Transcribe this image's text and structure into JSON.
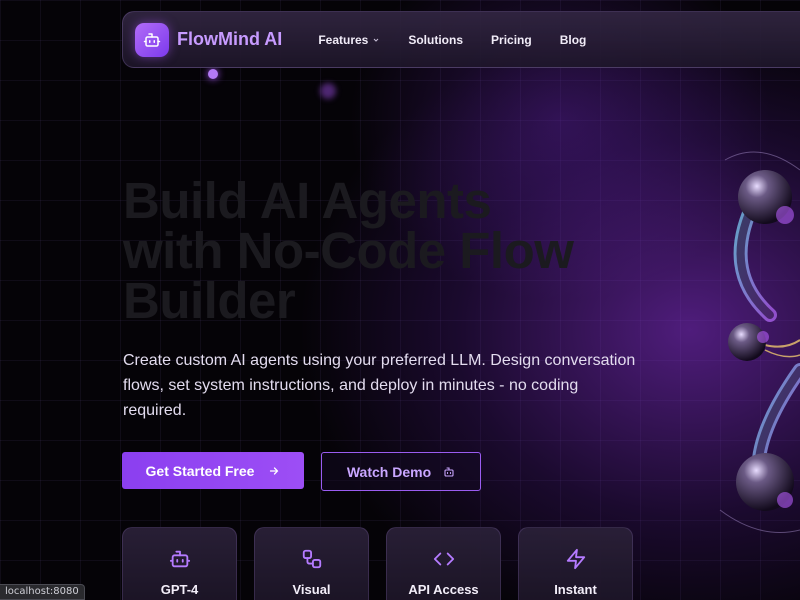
{
  "brand": {
    "name": "FlowMind AI",
    "logo_icon": "bot-icon"
  },
  "nav": {
    "features": "Features",
    "solutions": "Solutions",
    "pricing": "Pricing",
    "blog": "Blog"
  },
  "hero": {
    "title_line1": "Build AI Agents",
    "title_line2": "with No-Code Flow",
    "title_line3": "Builder",
    "subtitle": "Create custom AI agents using your preferred LLM. Design conversation flows, set system instructions, and deploy in minutes - no coding required."
  },
  "cta": {
    "primary_label": "Get Started Free",
    "secondary_label": "Watch Demo"
  },
  "features": [
    {
      "label": "GPT-4",
      "icon": "bot-icon"
    },
    {
      "label": "Visual",
      "icon": "workflow-icon"
    },
    {
      "label": "API Access",
      "icon": "code-icon"
    },
    {
      "label": "Instant",
      "icon": "zap-icon"
    }
  ],
  "status_bar": {
    "url": "localhost:8080"
  },
  "colors": {
    "accent": "#9d4ef5",
    "accent_light": "#c79bff",
    "background": "#050307",
    "card": "#2a2038"
  }
}
